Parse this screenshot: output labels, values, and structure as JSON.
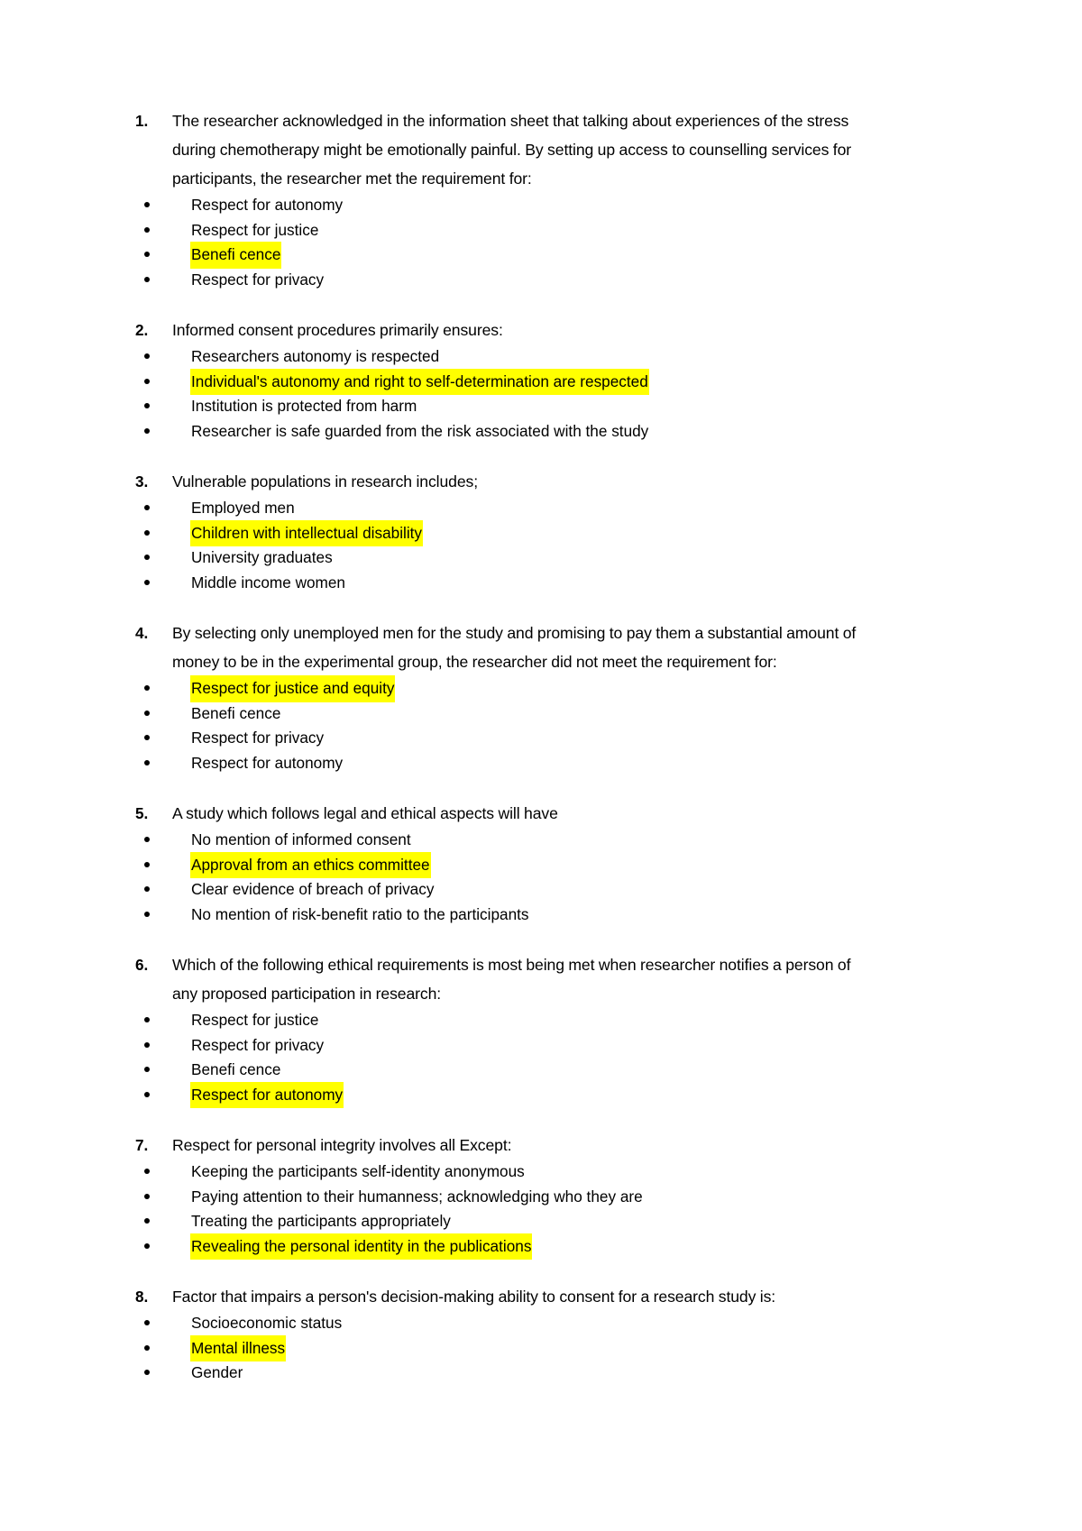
{
  "document": {
    "type": "quiz-worksheet",
    "highlight_color": "#ffff00",
    "text_color": "#000000",
    "background_color": "#ffffff",
    "questions": [
      {
        "number": "1.",
        "stem": "The researcher acknowledged in the information sheet that talking about experiences of the stress during chemotherapy might be emotionally painful. By setting up access to counselling services for participants, the researcher met the requirement for:",
        "options": [
          {
            "text": "Respect for autonomy",
            "highlighted": false
          },
          {
            "text": "Respect for justice",
            "highlighted": false
          },
          {
            "text": "Benefi cence",
            "highlighted": true
          },
          {
            "text": "Respect for privacy",
            "highlighted": false
          }
        ]
      },
      {
        "number": "2.",
        "stem": "Informed consent procedures primarily ensures:",
        "options": [
          {
            "text": "Researchers autonomy is respected",
            "highlighted": false
          },
          {
            "text": "Individual's autonomy and right to self-determination are respected",
            "highlighted": true
          },
          {
            "text": "Institution is protected from harm",
            "highlighted": false
          },
          {
            "text": "Researcher is safe guarded from the risk associated with the study",
            "highlighted": false
          }
        ]
      },
      {
        "number": "3.",
        "stem": "Vulnerable populations in research includes;",
        "options": [
          {
            "text": "Employed men",
            "highlighted": false
          },
          {
            "text": "Children with intellectual disability",
            "highlighted": true
          },
          {
            "text": "University graduates",
            "highlighted": false
          },
          {
            "text": "Middle income women",
            "highlighted": false
          }
        ]
      },
      {
        "number": "4.",
        "stem": "By selecting only unemployed men for the study and promising to pay them a substantial amount of money to be in the experimental group, the researcher did not meet the requirement for:",
        "options": [
          {
            "text": "Respect for justice and equity",
            "highlighted": true
          },
          {
            "text": "Benefi cence",
            "highlighted": false
          },
          {
            "text": "Respect for privacy",
            "highlighted": false
          },
          {
            "text": "Respect for autonomy",
            "highlighted": false
          }
        ]
      },
      {
        "number": "5.",
        "stem": "A study which follows legal and ethical aspects will have",
        "options": [
          {
            "text": "No mention of informed consent",
            "highlighted": false
          },
          {
            "text": "Approval from an ethics committee",
            "highlighted": true
          },
          {
            "text": "Clear evidence of breach of privacy",
            "highlighted": false
          },
          {
            "text": "No mention of risk-benefit ratio to the participants",
            "highlighted": false
          }
        ]
      },
      {
        "number": "6.",
        "stem": "Which of the following ethical requirements is most being met when researcher notifies a person of any proposed participation in research:",
        "options": [
          {
            "text": "Respect for justice",
            "highlighted": false
          },
          {
            "text": "Respect for privacy",
            "highlighted": false
          },
          {
            "text": "Benefi cence",
            "highlighted": false
          },
          {
            "text": "Respect for autonomy",
            "highlighted": true
          }
        ]
      },
      {
        "number": "7.",
        "stem": "Respect for personal integrity involves all Except:",
        "options": [
          {
            "text": "Keeping the participants self-identity anonymous",
            "highlighted": false
          },
          {
            "text": "Paying attention to their humanness; acknowledging who they are",
            "highlighted": false
          },
          {
            "text": "Treating the participants appropriately",
            "highlighted": false
          },
          {
            "text": "Revealing the personal identity in the publications",
            "highlighted": true
          }
        ]
      },
      {
        "number": "8.",
        "stem": "Factor that impairs a person's decision-making ability to consent for a research study is:",
        "options": [
          {
            "text": "Socioeconomic status",
            "highlighted": false
          },
          {
            "text": "Mental illness",
            "highlighted": true
          },
          {
            "text": "Gender",
            "highlighted": false
          }
        ]
      }
    ]
  }
}
